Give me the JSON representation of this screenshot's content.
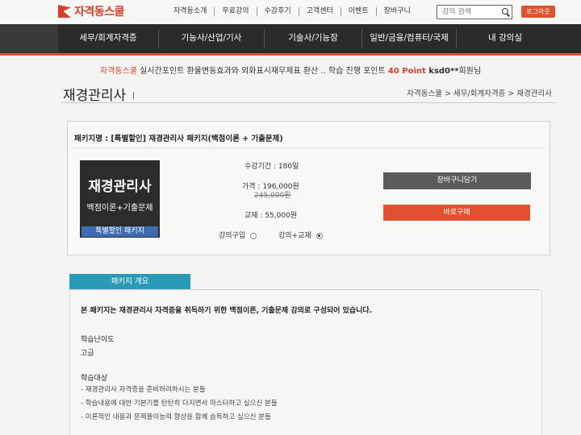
{
  "header": {
    "logo_text": "자격동스쿨",
    "nav": [
      "자격동소개",
      "무료강의",
      "수강후기",
      "고객센터",
      "이벤트",
      "장바구니"
    ],
    "search_placeholder": "강의 검색",
    "logout_label": "로그아웃"
  },
  "main_nav": [
    "세무/회계자격증",
    "기능사/산업/기사",
    "기술사/기능장",
    "일반/금융/컴퓨터/국제",
    "내 강의실"
  ],
  "notice": {
    "brand": "자격동스쿨",
    "text": " 실시간포인트 환율변동효과와 외화표시재무제표 환산 .. 학습 진행 포인트 ",
    "points": "40 Point",
    "user": " ksd0**",
    "suffix": "회원님"
  },
  "page_title": "재경관리사",
  "breadcrumb": "자격동스쿨 > 세무/회계자격증 > 재경관리사",
  "package": {
    "name": "패키지명 : [특별할인] 재경관리사 패키지(백점이론 + 기출문제)",
    "thumb_title": "재경관리사",
    "thumb_sub": "백점이론+기출문제",
    "thumb_band": "특별할인 패키지",
    "period": "수강기간 : 180일",
    "price": "가격 : 196,000원",
    "original_price": "245,000원",
    "book": "교재 : 55,000원",
    "option_lecture": "강의구입",
    "option_lecture_book": "강의+교재",
    "selected_option": "강의+교재",
    "cart_label": "장바구니담기",
    "buy_label": "바로구매"
  },
  "overview": {
    "tab_label": "패키지 개요",
    "intro": "본 패키지는 재경관리사 자격증을 취득하기 위한 백점이론, 기출문제 강의로 구성되어 있습니다.",
    "difficulty_head": "학습난이도",
    "difficulty_value": "고급",
    "target_head": "학습대상",
    "targets": [
      "- 재경관리사 자격증을 준비하려하시는 분들",
      "- 학습내용에 대한 기본기를 탄탄히 다지면서 마스터하고 싶으신 분들",
      "- 이론적인 내용과 문제풀이능력 향상을 함께 습득하고 싶으신 분들"
    ]
  }
}
